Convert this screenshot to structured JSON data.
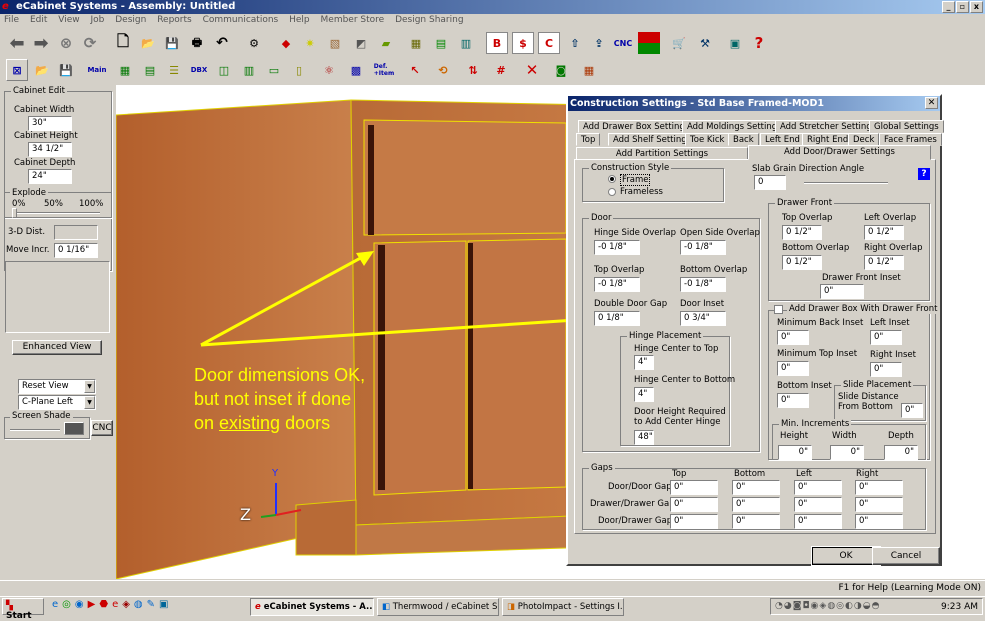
{
  "window": {
    "title": "eCabinet Systems - Assembly: Untitled"
  },
  "menu": [
    "File",
    "Edit",
    "View",
    "Job",
    "Design",
    "Reports",
    "Communications",
    "Help",
    "Member Store",
    "Design Sharing"
  ],
  "toolbar": {
    "cnc_label": "CNC"
  },
  "toolbar2": {
    "def_item_label": "Def.\n+Item"
  },
  "left_panel": {
    "cabinet_edit_title": "Cabinet Edit",
    "width_label": "Cabinet Width",
    "width_value": "30\"",
    "height_label": "Cabinet Height",
    "height_value": "34 1/2\"",
    "depth_label": "Cabinet Depth",
    "depth_value": "24\"",
    "explode_title": "Explode",
    "explode_0": "0%",
    "explode_50": "50%",
    "explode_100": "100%",
    "dist_label": "3-D Dist.",
    "move_label": "Move Incr.",
    "move_value": "0 1/16\"",
    "enhanced_view": "Enhanced View",
    "reset_view": "Reset View",
    "cplane": "C-Plane Left",
    "screen_shade": "Screen Shade",
    "cnc_button": "CNC"
  },
  "viewport": {
    "annotation": [
      "Door dimensions OK,",
      "but not inset if done",
      "on existing doors"
    ],
    "axis_z": "Z",
    "axis_y": "Y"
  },
  "dialog": {
    "title": "Construction Settings - Std Base Framed-MOD1",
    "tabs_row1": [
      "Add Drawer Box Settings",
      "Add Moldings Settings",
      "Add Stretcher Settings",
      "Global Settings"
    ],
    "tabs_row2": [
      "Top",
      "Add Shelf Settings",
      "Toe Kick",
      "Back",
      "Left End",
      "Right End",
      "Deck",
      "Face Frames"
    ],
    "tabs_row3": [
      "Add Partition Settings",
      "Add Door/Drawer Settings"
    ],
    "construction_style": {
      "title": "Construction Style",
      "frame": "Frame",
      "frameless": "Frameless"
    },
    "slab_grain": {
      "label": "Slab Grain Direction Angle",
      "value": "0"
    },
    "help": "?",
    "door": {
      "title": "Door",
      "hinge_side_overlap": "Hinge Side Overlap",
      "hinge_side_value": "-0 1/8\"",
      "open_side_overlap": "Open Side Overlap",
      "open_side_value": "-0 1/8\"",
      "top_overlap": "Top Overlap",
      "top_value": "-0 1/8\"",
      "bottom_overlap": "Bottom Overlap",
      "bottom_value": "-0 1/8\"",
      "double_gap": "Double Door Gap",
      "double_gap_value": "0 1/8\"",
      "door_inset": "Door Inset",
      "door_inset_value": "0 3/4\""
    },
    "hinge": {
      "title": "Hinge Placement",
      "center_top": "Hinge Center to Top",
      "center_top_value": "4\"",
      "center_bottom": "Hinge Center to Bottom",
      "center_bottom_value": "4\"",
      "height_req_1": "Door Height Required",
      "height_req_2": "to Add Center Hinge",
      "height_req_value": "48\""
    },
    "drawer_front": {
      "title": "Drawer Front",
      "top_overlap": "Top Overlap",
      "top_value": "0 1/2\"",
      "left_overlap": "Left Overlap",
      "left_value": "0 1/2\"",
      "bottom_overlap": "Bottom Overlap",
      "bottom_value": "0 1/2\"",
      "right_overlap": "Right Overlap",
      "right_value": "0 1/2\"",
      "inset": "Drawer Front Inset",
      "inset_value": "0\""
    },
    "drawer_box": {
      "checkbox": "Add Drawer Box With Drawer Front",
      "min_back": "Minimum Back Inset",
      "min_back_value": "0\"",
      "left_inset": "Left Inset",
      "left_inset_value": "0\"",
      "min_top": "Minimum Top Inset",
      "min_top_value": "0\"",
      "right_inset": "Right Inset",
      "right_inset_value": "0\"",
      "bottom_inset": "Bottom Inset",
      "bottom_inset_value": "0\"",
      "slide_title": "Slide Placement",
      "slide_1": "Slide Distance",
      "slide_2": "From Bottom",
      "slide_value": "0\""
    },
    "min_incr": {
      "title": "Min. Increments",
      "height": "Height",
      "height_value": "0\"",
      "width": "Width",
      "width_value": "0\"",
      "depth": "Depth",
      "depth_value": "0\""
    },
    "gaps": {
      "title": "Gaps",
      "cols": [
        "Top",
        "Bottom",
        "Left",
        "Right"
      ],
      "rows": [
        {
          "label": "Door/Door Gap",
          "values": [
            "0\"",
            "0\"",
            "0\"",
            "0\""
          ]
        },
        {
          "label": "Drawer/Drawer Gap",
          "values": [
            "0\"",
            "0\"",
            "0\"",
            "0\""
          ]
        },
        {
          "label": "Door/Drawer Gap",
          "values": [
            "0\"",
            "0\"",
            "0\"",
            "0\""
          ]
        }
      ]
    },
    "ok": "OK",
    "cancel": "Cancel"
  },
  "status": {
    "text": "F1 for Help (Learning Mode ON)"
  },
  "taskbar": {
    "start": "Start",
    "items": [
      "eCabinet Systems - A...",
      "Thermwood / eCabinet S...",
      "PhotoImpact - Settings I..."
    ],
    "time": "9:23 AM"
  }
}
